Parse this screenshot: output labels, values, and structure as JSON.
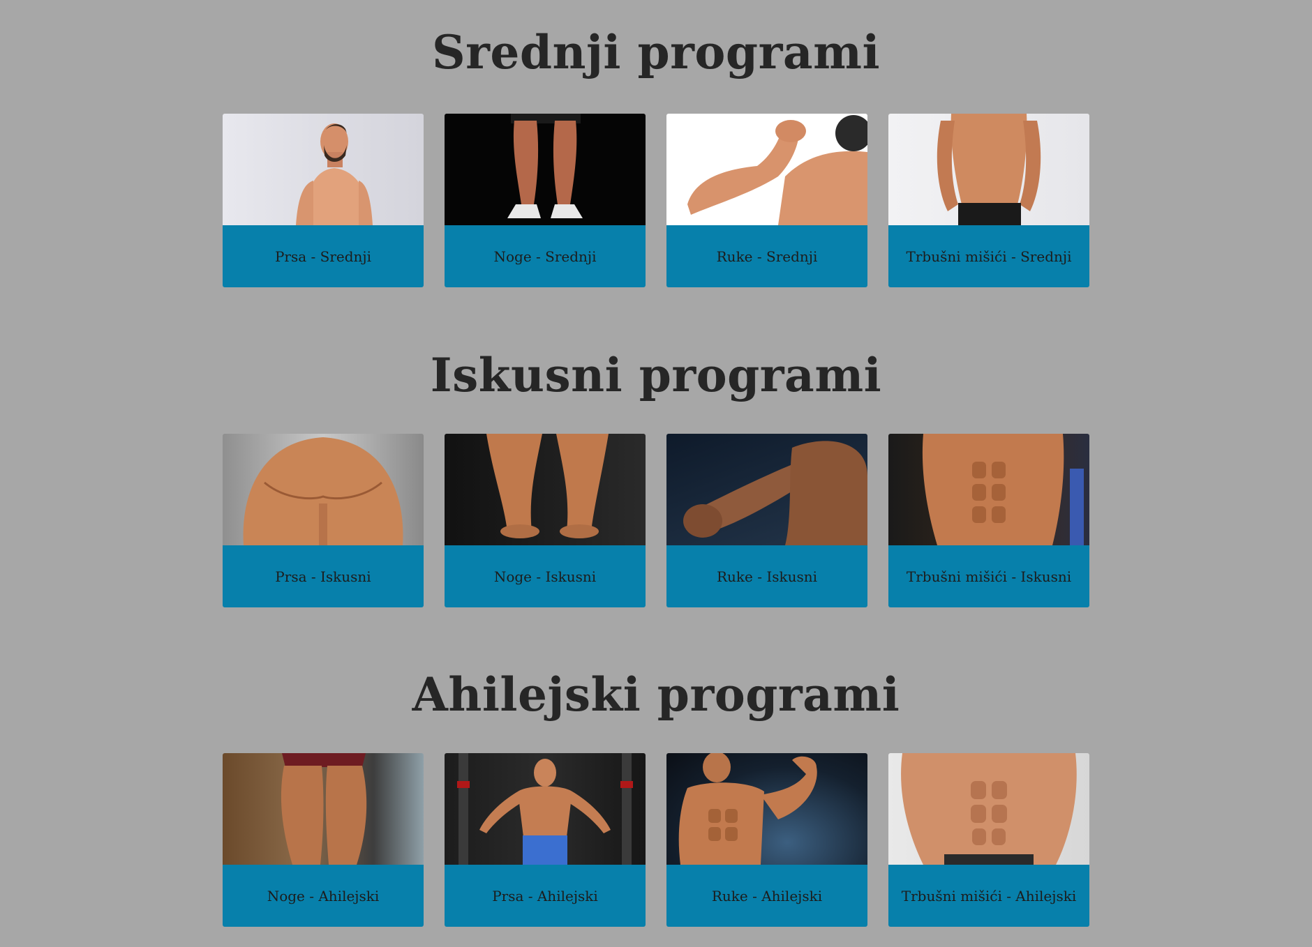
{
  "sections": [
    {
      "title": "Srednji programi",
      "cards": [
        {
          "label": "Prsa - Srednji"
        },
        {
          "label": "Noge - Srednji"
        },
        {
          "label": "Ruke - Srednji"
        },
        {
          "label": "Trbušni mišići - Srednji"
        }
      ]
    },
    {
      "title": "Iskusni programi",
      "cards": [
        {
          "label": "Prsa - Iskusni"
        },
        {
          "label": "Noge - Iskusni"
        },
        {
          "label": "Ruke - Iskusni"
        },
        {
          "label": "Trbušni mišići - Iskusni"
        }
      ]
    },
    {
      "title": "Ahilejski programi",
      "cards": [
        {
          "label": "Noge - Ahilejski"
        },
        {
          "label": "Prsa - Ahilejski"
        },
        {
          "label": "Ruke - Ahilejski"
        },
        {
          "label": "Trbušni mišići - Ahilejski"
        }
      ]
    }
  ],
  "colors": {
    "background": "#a7a7a7",
    "caption": "#0780ab",
    "title_text": "#262626"
  }
}
